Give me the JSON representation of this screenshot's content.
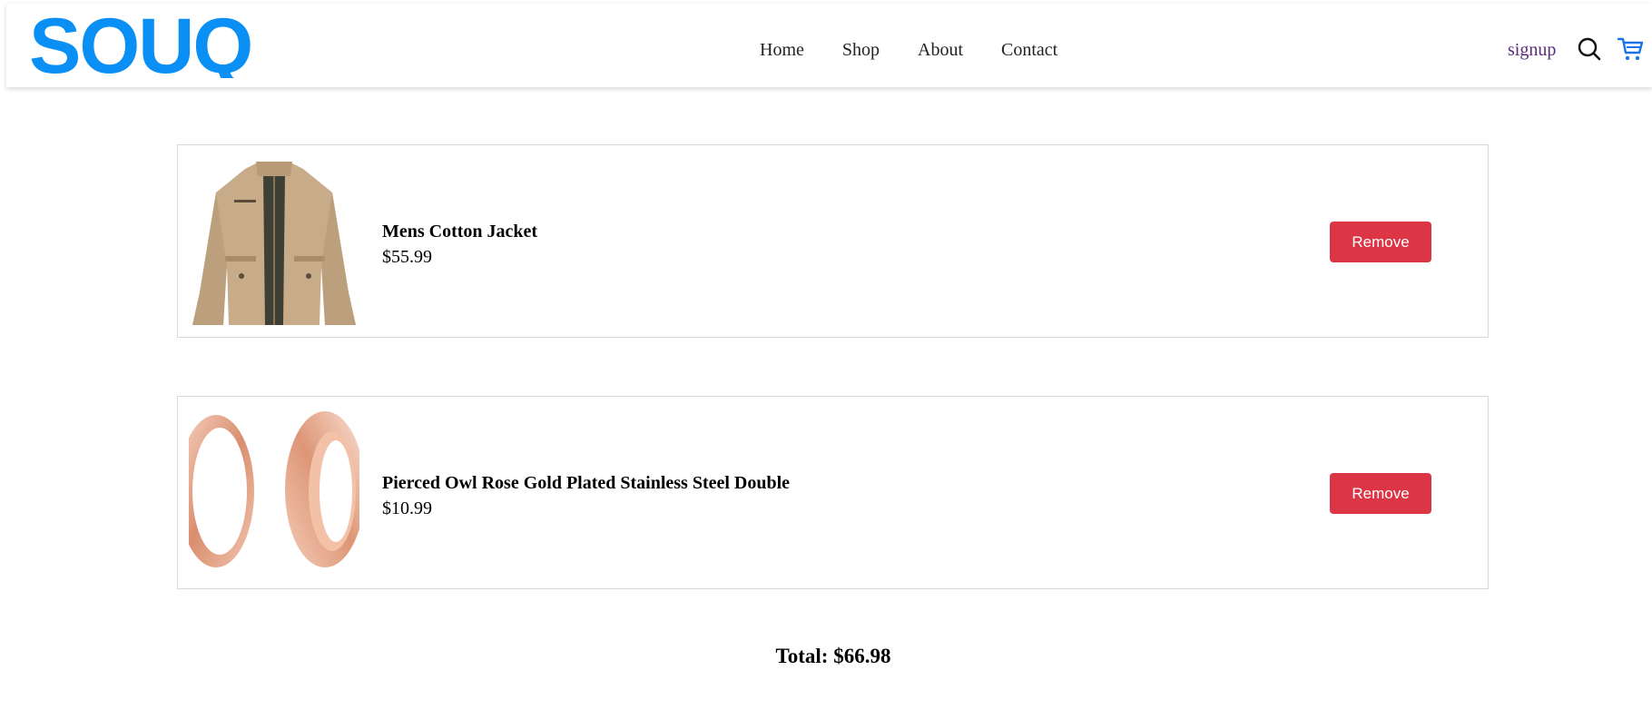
{
  "brand": {
    "logo_text": "SOUQ",
    "logo_color": "#0a90f5"
  },
  "nav": {
    "links": [
      {
        "label": "Home"
      },
      {
        "label": "Shop"
      },
      {
        "label": "About"
      },
      {
        "label": "Contact"
      }
    ],
    "signup_label": "signup",
    "search_icon": "search-icon",
    "cart_icon": "cart-icon"
  },
  "cart": {
    "items": [
      {
        "title": "Mens Cotton Jacket",
        "price": "$55.99",
        "remove_label": "Remove",
        "image": "jacket-image"
      },
      {
        "title": "Pierced Owl Rose Gold Plated Stainless Steel Double",
        "price": "$10.99",
        "remove_label": "Remove",
        "image": "rose-gold-rings-image"
      }
    ],
    "total_text": "Total: $66.98"
  },
  "colors": {
    "remove_button": "#dc3545",
    "signup_link": "#5a2a7a",
    "cart_icon": "#1a73e8"
  }
}
